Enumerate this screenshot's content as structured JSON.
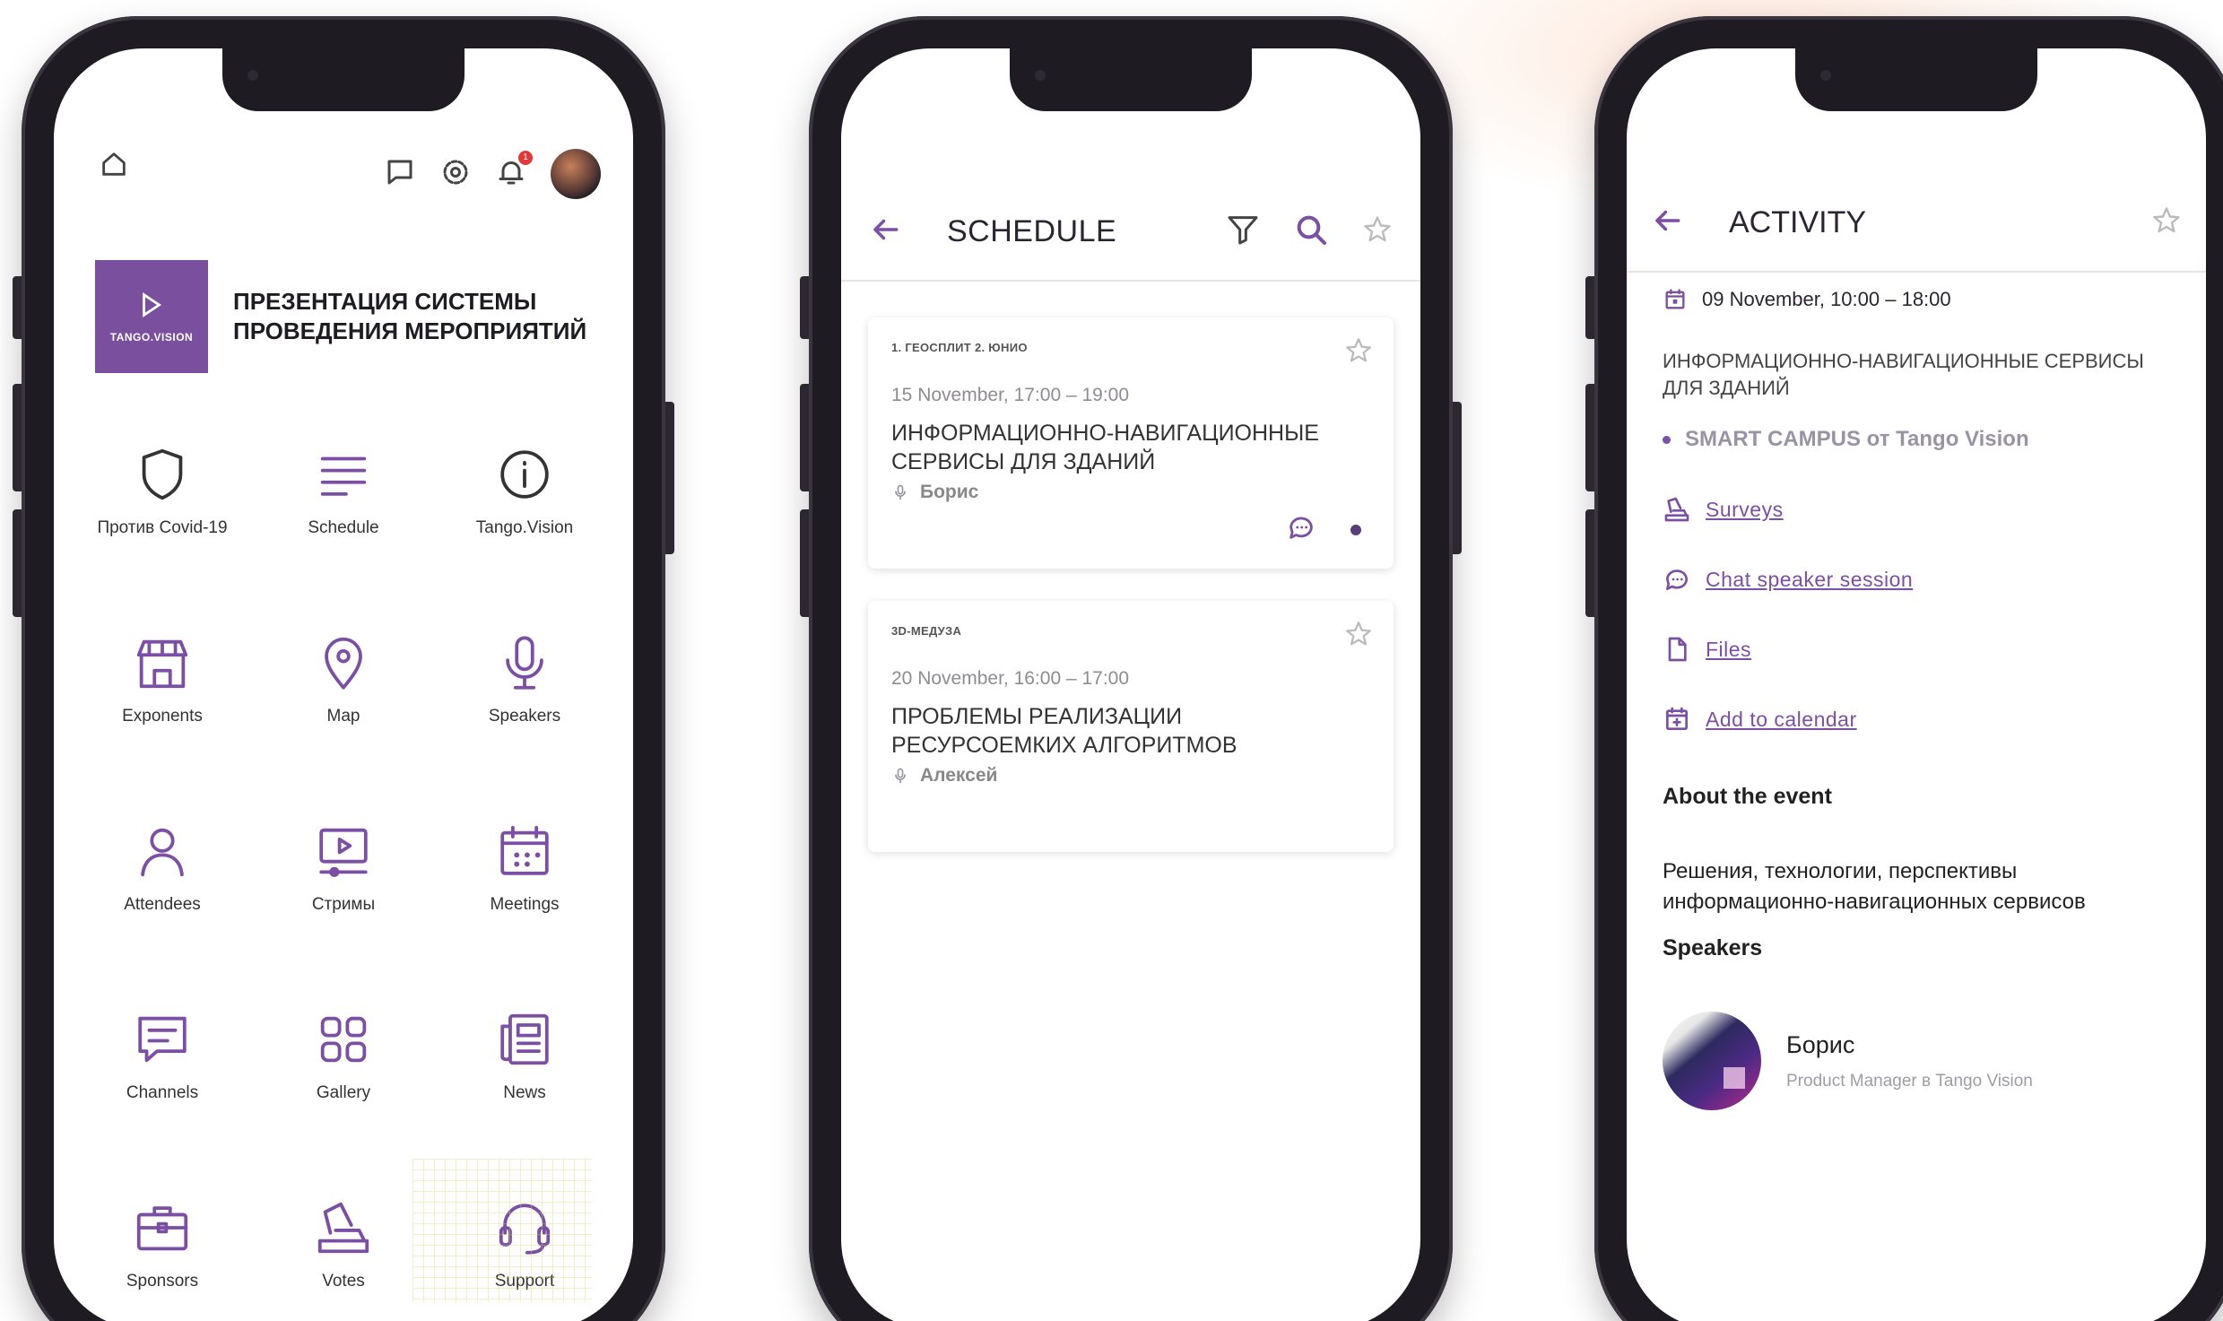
{
  "phone1": {
    "title": "ПРЕЗЕНТАЦИЯ СИСТЕМЫ ПРОВЕДЕНИЯ МЕРОПРИЯТИЙ",
    "logo_text": "TANGO.VISION",
    "notification_count": "1",
    "tiles": [
      {
        "label": "Против Covid-19",
        "icon": "shield-icon"
      },
      {
        "label": "Schedule",
        "icon": "list-lines-icon"
      },
      {
        "label": "Tango.Vision",
        "icon": "info-icon"
      },
      {
        "label": "Exponents",
        "icon": "store-icon"
      },
      {
        "label": "Map",
        "icon": "map-pin-icon"
      },
      {
        "label": "Speakers",
        "icon": "microphone-icon"
      },
      {
        "label": "Attendees",
        "icon": "person-icon"
      },
      {
        "label": "Стримы",
        "icon": "video-player-icon"
      },
      {
        "label": "Meetings",
        "icon": "calendar-icon"
      },
      {
        "label": "Channels",
        "icon": "chat-bubble-icon"
      },
      {
        "label": "Gallery",
        "icon": "gallery-grid-icon"
      },
      {
        "label": "News",
        "icon": "newspaper-icon"
      },
      {
        "label": "Sponsors",
        "icon": "briefcase-icon"
      },
      {
        "label": "Votes",
        "icon": "ballot-icon"
      },
      {
        "label": "Support",
        "icon": "headset-icon"
      }
    ]
  },
  "phone2": {
    "title": "SCHEDULE",
    "cards": [
      {
        "room": "1. ГЕОСПЛИТ 2. ЮНИО",
        "time": "15 November, 17:00 – 19:00",
        "title": "ИНФОРМАЦИОННО-НАВИГАЦИОННЫЕ СЕРВИСЫ ДЛЯ ЗДАНИЙ",
        "speaker": "Борис"
      },
      {
        "room": "3D-МЕДУЗА",
        "time": "20 November, 16:00 – 17:00",
        "title": "ПРОБЛЕМЫ РЕАЛИЗАЦИИ РЕСУРСОЕМКИХ АЛГОРИТМОВ",
        "speaker": "Алексей"
      }
    ]
  },
  "phone3": {
    "title": "ACTIVITY",
    "date": "09 November, 10:00 – 18:00",
    "event_title": "ИНФОРМАЦИОННО-НАВИГАЦИОННЫЕ СЕРВИСЫ ДЛЯ ЗДАНИЙ",
    "place": "SMART CAMPUS от Tango Vision",
    "links": {
      "surveys": "Surveys",
      "chat": "Chat speaker session",
      "files": "Files",
      "calendar": "Add to calendar"
    },
    "about_heading": "About the event",
    "description": "Решения, технологии, перспективы информационно-навигационных сервисов",
    "speakers_heading": "Speakers",
    "speaker_name": "Борис",
    "speaker_role": "Product Manager в Tango Vision"
  },
  "colors": {
    "accent": "#7b4fa3",
    "phone_frame": "#1f1b22",
    "logo_bg": "#7a4f9e"
  }
}
